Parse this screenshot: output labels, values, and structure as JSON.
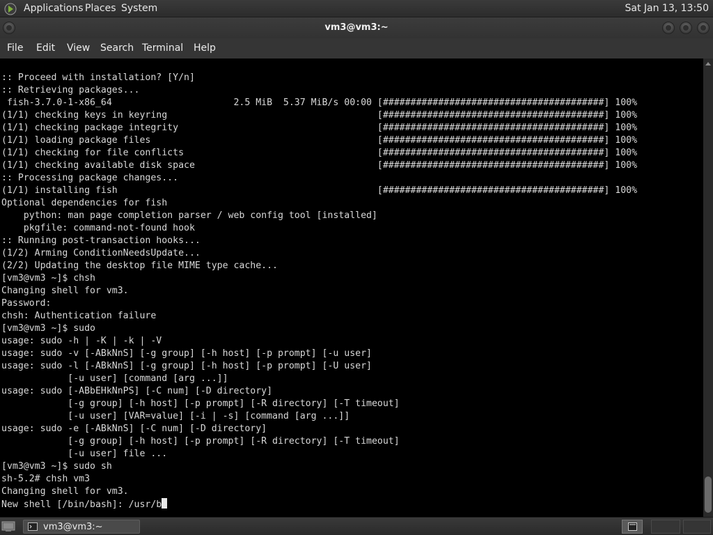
{
  "top_panel": {
    "menus": [
      "Applications",
      "Places",
      "System"
    ],
    "clock": "Sat Jan 13, 13:50"
  },
  "window": {
    "title": "vm3@vm3:~"
  },
  "menubar": [
    "File",
    "Edit",
    "View",
    "Search",
    "Terminal",
    "Help"
  ],
  "terminal": {
    "lines": [
      ":: Proceed with installation? [Y/n]",
      ":: Retrieving packages...",
      " fish-3.7.0-1-x86_64                      2.5 MiB  5.37 MiB/s 00:00 [########################################] 100%",
      "(1/1) checking keys in keyring                                      [########################################] 100%",
      "(1/1) checking package integrity                                    [########################################] 100%",
      "(1/1) loading package files                                         [########################################] 100%",
      "(1/1) checking for file conflicts                                   [########################################] 100%",
      "(1/1) checking available disk space                                 [########################################] 100%",
      ":: Processing package changes...",
      "(1/1) installing fish                                               [########################################] 100%",
      "Optional dependencies for fish",
      "    python: man page completion parser / web config tool [installed]",
      "    pkgfile: command-not-found hook",
      ":: Running post-transaction hooks...",
      "(1/2) Arming ConditionNeedsUpdate...",
      "(2/2) Updating the desktop file MIME type cache...",
      "[vm3@vm3 ~]$ chsh",
      "Changing shell for vm3.",
      "Password:",
      "chsh: Authentication failure",
      "[vm3@vm3 ~]$ sudo",
      "usage: sudo -h | -K | -k | -V",
      "usage: sudo -v [-ABkNnS] [-g group] [-h host] [-p prompt] [-u user]",
      "usage: sudo -l [-ABkNnS] [-g group] [-h host] [-p prompt] [-U user]",
      "            [-u user] [command [arg ...]]",
      "usage: sudo [-ABbEHkNnPS] [-C num] [-D directory]",
      "            [-g group] [-h host] [-p prompt] [-R directory] [-T timeout]",
      "            [-u user] [VAR=value] [-i | -s] [command [arg ...]]",
      "usage: sudo -e [-ABkNnS] [-C num] [-D directory]",
      "            [-g group] [-h host] [-p prompt] [-R directory] [-T timeout]",
      "            [-u user] file ...",
      "[vm3@vm3 ~]$ sudo sh",
      "sh-5.2# chsh vm3",
      "Changing shell for vm3."
    ],
    "prompt_line": "New shell [/bin/bash]: /usr/b"
  },
  "taskbar": {
    "task_label": "vm3@vm3:~"
  },
  "icons": {
    "app_logo": "gnome-foot-icon",
    "show_desktop": "show-desktop-icon",
    "task": "terminal-icon",
    "workspace": "terminal-icon"
  }
}
